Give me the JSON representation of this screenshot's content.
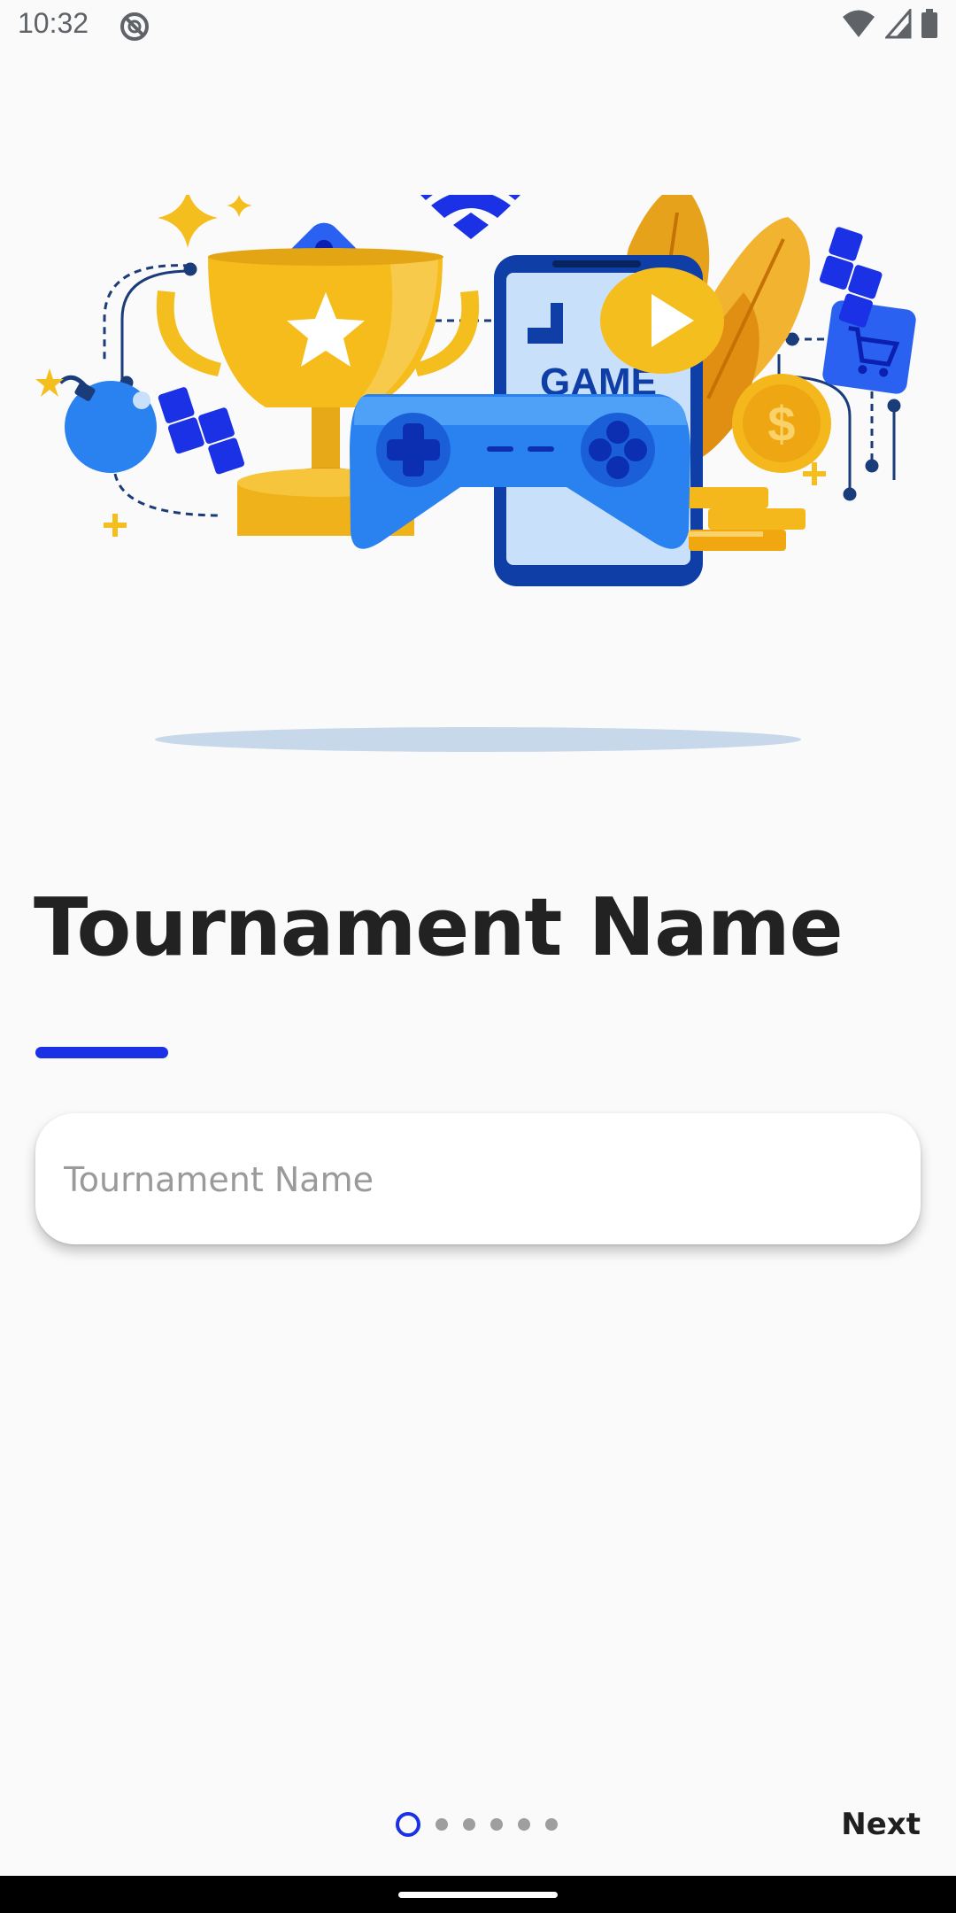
{
  "status_bar": {
    "time": "10:32",
    "icons": [
      "do-not-disturb-icon",
      "wifi-icon",
      "cell-signal-icon",
      "battery-icon"
    ]
  },
  "hero": {
    "screen_label": "GAME",
    "icons": [
      "trophy-icon",
      "dice-icon",
      "wifi-icon",
      "phone-icon",
      "play-icon",
      "gamepad-icon",
      "coin-icon",
      "cart-icon",
      "bomb-icon",
      "tetromino-icon",
      "sparkle-icon",
      "leaf-icon"
    ]
  },
  "page": {
    "title": "Tournament Name",
    "accent_color": "#1a31e6"
  },
  "form": {
    "name_field": {
      "value": "",
      "placeholder": "Tournament Name"
    }
  },
  "pager": {
    "total": 6,
    "current": 1
  },
  "footer": {
    "next_label": "Next"
  }
}
